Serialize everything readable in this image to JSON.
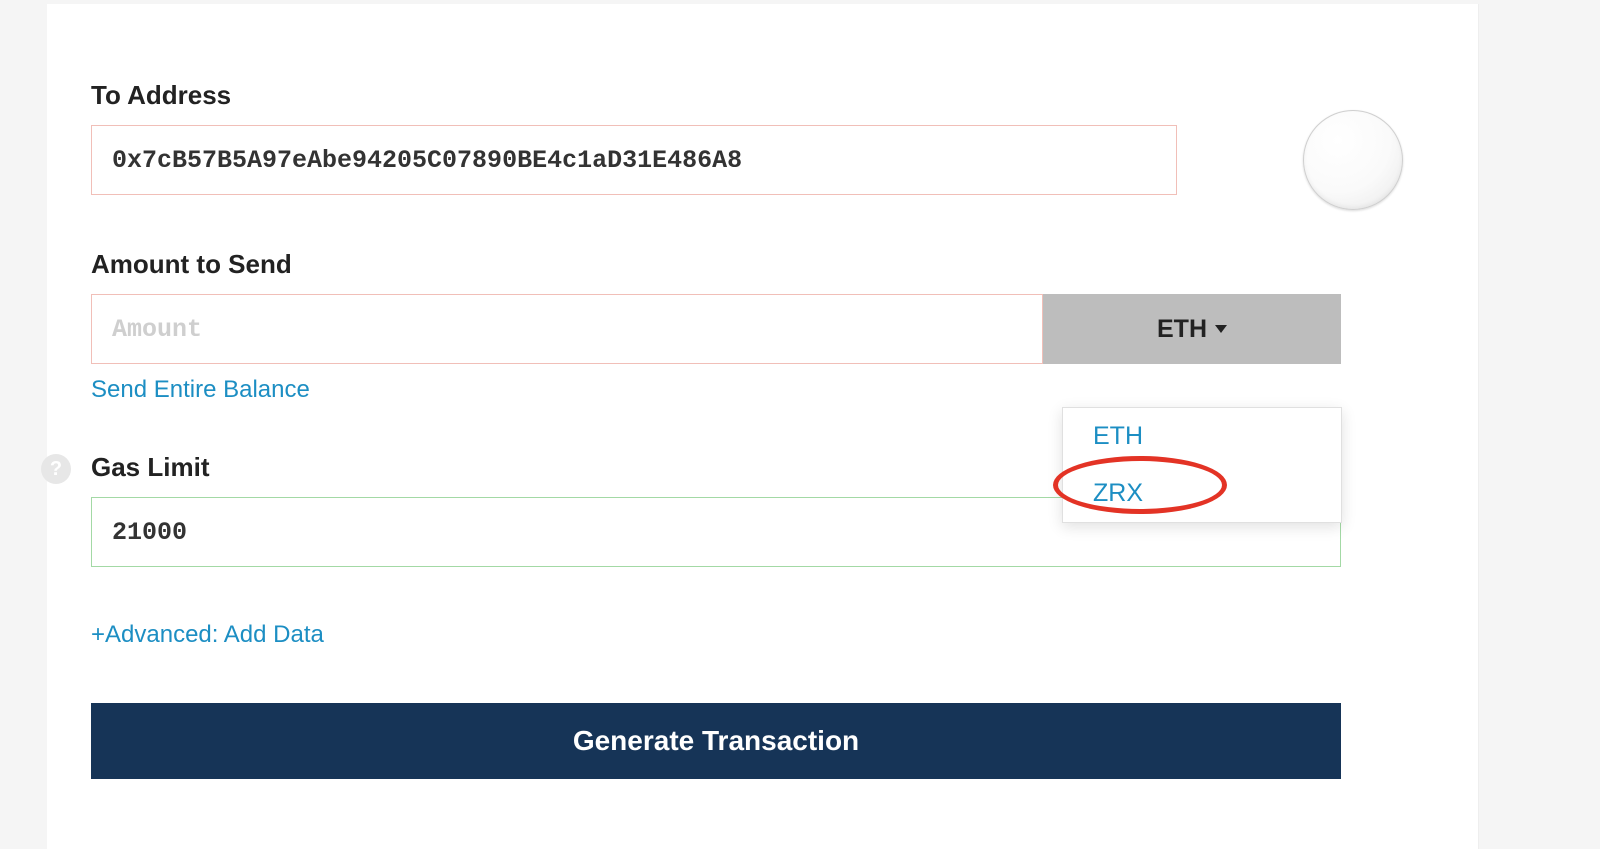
{
  "to": {
    "label": "To Address",
    "value": "0x7cB57B5A97eAbe94205C07890BE4c1aD31E486A8"
  },
  "amount": {
    "label": "Amount to Send",
    "placeholder": "Amount",
    "unit_selected": "ETH",
    "send_entire": "Send Entire Balance",
    "options": [
      "ETH",
      "ZRX"
    ]
  },
  "gas": {
    "label": "Gas Limit",
    "value": "21000"
  },
  "advanced_link": "+Advanced: Add Data",
  "generate_label": "Generate Transaction",
  "help_symbol": "?"
}
